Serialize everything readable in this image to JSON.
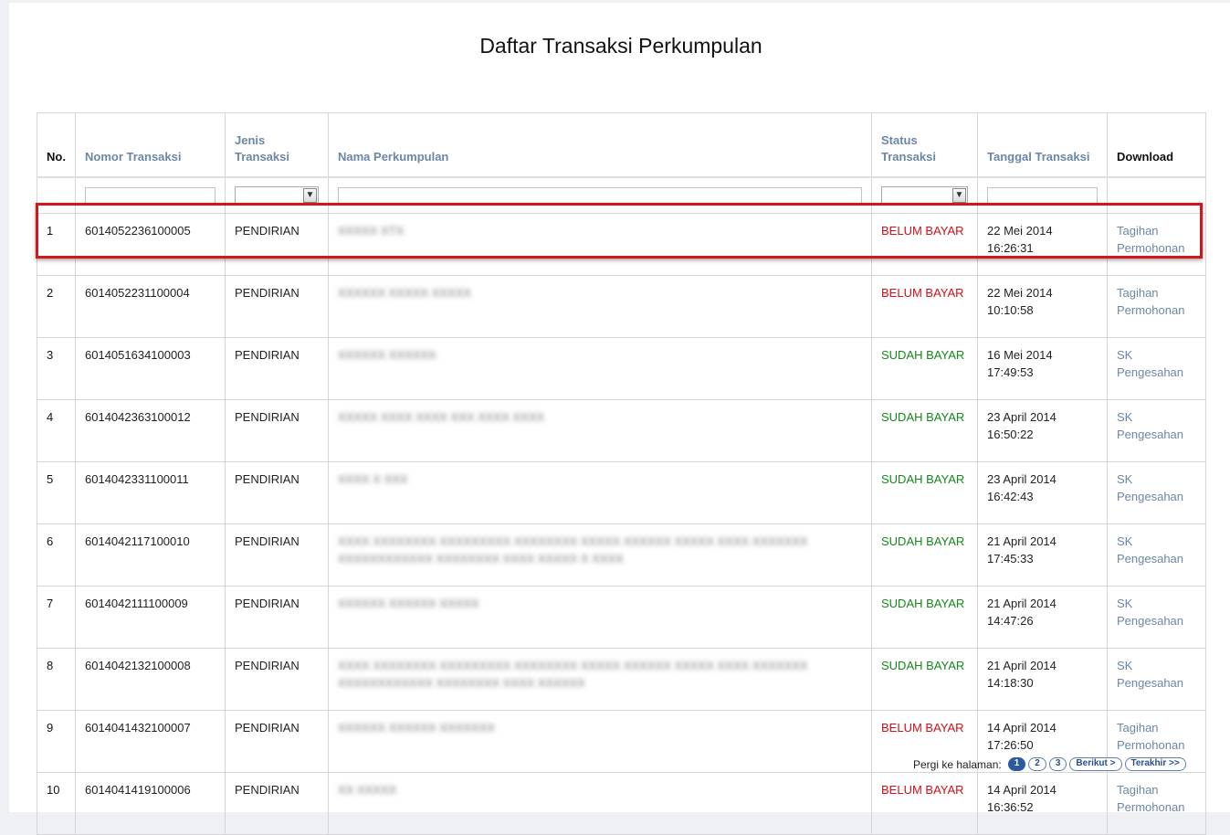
{
  "title": "Daftar Transaksi Perkumpulan",
  "columns": {
    "no": "No.",
    "nomor": "Nomor Transaksi",
    "jenis_line1": "Jenis",
    "jenis_line2": "Transaksi",
    "nama": "Nama Perkumpulan",
    "status_line1": "Status",
    "status_line2": "Transaksi",
    "tanggal": "Tanggal Transaksi",
    "download": "Download"
  },
  "rows": [
    {
      "no": "1",
      "nomor": "6014052236100005",
      "jenis": "PENDIRIAN",
      "nama": "XXXXX XTX",
      "status": "BELUM BAYAR",
      "paid": false,
      "date": "22 Mei 2014",
      "time": "16:26:31",
      "dl1": "Tagihan",
      "dl2": "Permohonan"
    },
    {
      "no": "2",
      "nomor": "6014052231100004",
      "jenis": "PENDIRIAN",
      "nama": "XXXXXX XXXXX XXXXX",
      "status": "BELUM BAYAR",
      "paid": false,
      "date": "22 Mei 2014",
      "time": "10:10:58",
      "dl1": "Tagihan",
      "dl2": "Permohonan"
    },
    {
      "no": "3",
      "nomor": "6014051634100003",
      "jenis": "PENDIRIAN",
      "nama": "XXXXXX XXXXXX",
      "status": "SUDAH BAYAR",
      "paid": true,
      "date": "16 Mei 2014",
      "time": "17:49:53",
      "dl1": "SK",
      "dl2": "Pengesahan"
    },
    {
      "no": "4",
      "nomor": "6014042363100012",
      "jenis": "PENDIRIAN",
      "nama": "XXXXX XXXX XXXX XXX XXXX XXXX",
      "status": "SUDAH BAYAR",
      "paid": true,
      "date": "23 April 2014",
      "time": "16:50:22",
      "dl1": "SK",
      "dl2": "Pengesahan"
    },
    {
      "no": "5",
      "nomor": "6014042331100011",
      "jenis": "PENDIRIAN",
      "nama": "XXXX X XXX",
      "status": "SUDAH BAYAR",
      "paid": true,
      "date": "23 April 2014",
      "time": "16:42:43",
      "dl1": "SK",
      "dl2": "Pengesahan"
    },
    {
      "no": "6",
      "nomor": "6014042117100010",
      "jenis": "PENDIRIAN",
      "nama": "XXXX XXXXXXXX XXXXXXXXX XXXXXXXX XXXXX XXXXXX XXXXX XXXX XXXXXXX XXXXXXXXXXXX XXXXXXXX XXXX XXXXX X XXXX",
      "status": "SUDAH BAYAR",
      "paid": true,
      "date": "21 April 2014",
      "time": "17:45:33",
      "dl1": "SK",
      "dl2": "Pengesahan"
    },
    {
      "no": "7",
      "nomor": "6014042111100009",
      "jenis": "PENDIRIAN",
      "nama": "XXXXXX XXXXXX XXXXX",
      "status": "SUDAH BAYAR",
      "paid": true,
      "date": "21 April 2014",
      "time": "14:47:26",
      "dl1": "SK",
      "dl2": "Pengesahan"
    },
    {
      "no": "8",
      "nomor": "6014042132100008",
      "jenis": "PENDIRIAN",
      "nama": "XXXX XXXXXXXX XXXXXXXXX XXXXXXXX XXXXX XXXXXX XXXXX XXXX XXXXXXX XXXXXXXXXXXX XXXXXXXX XXXX XXXXXX",
      "status": "SUDAH BAYAR",
      "paid": true,
      "date": "21 April 2014",
      "time": "14:18:30",
      "dl1": "SK",
      "dl2": "Pengesahan"
    },
    {
      "no": "9",
      "nomor": "6014041432100007",
      "jenis": "PENDIRIAN",
      "nama": "XXXXXX XXXXXX XXXXXXX",
      "status": "BELUM BAYAR",
      "paid": false,
      "date": "14 April 2014",
      "time": "17:26:50",
      "dl1": "Tagihan",
      "dl2": "Permohonan"
    },
    {
      "no": "10",
      "nomor": "6014041419100006",
      "jenis": "PENDIRIAN",
      "nama": "XX XXXXX",
      "status": "BELUM BAYAR",
      "paid": false,
      "date": "14 April 2014",
      "time": "16:36:52",
      "dl1": "Tagihan",
      "dl2": "Permohonan"
    }
  ],
  "pager": {
    "label": "Pergi ke halaman:",
    "pages": [
      "1",
      "2",
      "3"
    ],
    "next": "Berikut >",
    "last": "Terakhir >>"
  },
  "colors": {
    "unpaid": "#d20f16",
    "paid": "#15891a",
    "link": "#6b87a8",
    "highlight": "#d0181c"
  },
  "icons": {
    "dropdown": "chevron-down-icon"
  }
}
